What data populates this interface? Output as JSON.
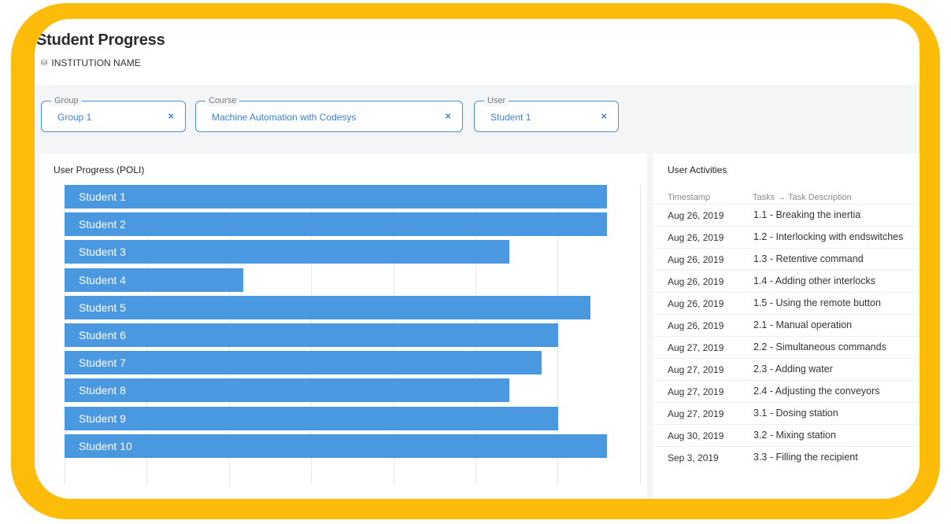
{
  "page": {
    "title": "Student Progress",
    "institution": "INSTITUTION NAME",
    "institution_icon": "database-icon"
  },
  "filters": {
    "group": {
      "label": "Group",
      "value": "Group 1",
      "clear_icon": "×"
    },
    "course": {
      "label": "Course",
      "value": "Machine Automation with Codesys",
      "clear_icon": "×"
    },
    "user": {
      "label": "User",
      "value": "Student 1",
      "clear_icon": "×"
    }
  },
  "progress_panel": {
    "title": "User Progress (POLI)"
  },
  "chart_data": {
    "type": "bar",
    "orientation": "horizontal",
    "title": "User Progress (POLI)",
    "categories": [
      "Student 1",
      "Student 2",
      "Student 3",
      "Student 4",
      "Student 5",
      "Student 6",
      "Student 7",
      "Student 8",
      "Student 9",
      "Student 10"
    ],
    "values": [
      100,
      100,
      82,
      33,
      97,
      91,
      88,
      82,
      91,
      100
    ],
    "xlim": [
      0,
      100
    ],
    "grid": true,
    "bar_color": "#4a98e0"
  },
  "activities": {
    "title": "User Activities",
    "columns": [
      "Timestamp",
      "Tasks → Task Description"
    ],
    "rows": [
      {
        "timestamp": "Aug 26, 2019",
        "task": "1.1 - Breaking the inertia"
      },
      {
        "timestamp": "Aug 26, 2019",
        "task": "1.2 - Interlocking with endswitches"
      },
      {
        "timestamp": "Aug 26, 2019",
        "task": "1.3 - Retentive command"
      },
      {
        "timestamp": "Aug 26, 2019",
        "task": "1.4 - Adding other interlocks"
      },
      {
        "timestamp": "Aug 26, 2019",
        "task": "1.5 - Using the remote button"
      },
      {
        "timestamp": "Aug 26, 2019",
        "task": "2.1 - Manual operation"
      },
      {
        "timestamp": "Aug 27, 2019",
        "task": "2.2 - Simultaneous commands"
      },
      {
        "timestamp": "Aug 27, 2019",
        "task": "2.3 - Adding water"
      },
      {
        "timestamp": "Aug 27, 2019",
        "task": "2.4 - Adjusting the conveyors"
      },
      {
        "timestamp": "Aug 27, 2019",
        "task": "3.1 - Dosing station"
      },
      {
        "timestamp": "Aug 30, 2019",
        "task": "3.2 - Mixing station"
      },
      {
        "timestamp": "Sep 3, 2019",
        "task": "3.3 - Filling the recipient"
      }
    ]
  },
  "colors": {
    "frame": "#fdbb0a",
    "accent": "#3c82d0",
    "bar": "#4a98e0"
  }
}
